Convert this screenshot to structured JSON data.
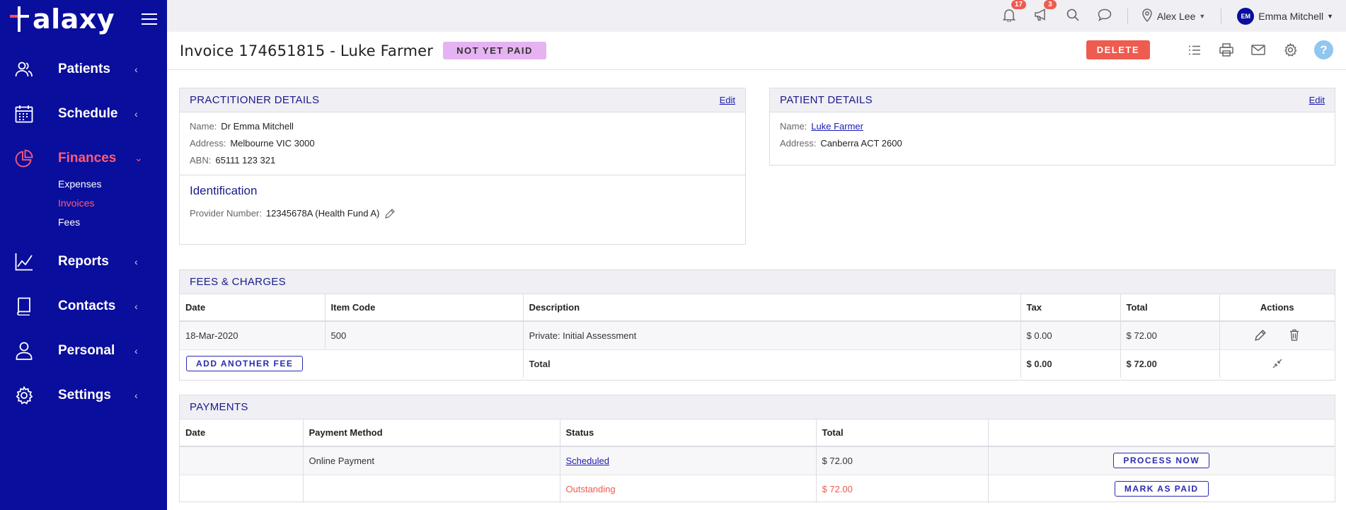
{
  "brand": {
    "name": "alaxy",
    "accent": "#ff4c6a",
    "sidebar_bg": "#0a0e9c"
  },
  "sidebar": {
    "items": [
      {
        "label": "Patients",
        "icon": "users-icon"
      },
      {
        "label": "Schedule",
        "icon": "calendar-icon"
      },
      {
        "label": "Finances",
        "icon": "pie-chart-icon",
        "active": true
      },
      {
        "label": "Reports",
        "icon": "line-chart-icon"
      },
      {
        "label": "Contacts",
        "icon": "book-icon"
      },
      {
        "label": "Personal",
        "icon": "user-icon"
      },
      {
        "label": "Settings",
        "icon": "gear-icon"
      }
    ],
    "finances_sub": [
      "Expenses",
      "Invoices",
      "Fees"
    ]
  },
  "topbar": {
    "notifications_count": "17",
    "announcements_count": "3",
    "location": "Alex Lee",
    "user_initials": "EM",
    "user_name": "Emma Mitchell"
  },
  "header": {
    "title": "Invoice 174651815 - Luke Farmer",
    "status": "NOT YET PAID",
    "delete_label": "DELETE",
    "help_label": "?"
  },
  "practitioner": {
    "heading": "PRACTITIONER DETAILS",
    "edit": "Edit",
    "name_label": "Name:",
    "name": "Dr Emma Mitchell",
    "address_label": "Address:",
    "address": "Melbourne VIC 3000",
    "abn_label": "ABN:",
    "abn": "65111 123 321",
    "ident_heading": "Identification",
    "provider_label": "Provider Number:",
    "provider_number": "12345678A (Health Fund A)"
  },
  "patient": {
    "heading": "PATIENT DETAILS",
    "edit": "Edit",
    "name_label": "Name:",
    "name": "Luke Farmer",
    "address_label": "Address:",
    "address": "Canberra ACT 2600"
  },
  "fees": {
    "heading": "FEES & CHARGES",
    "columns": [
      "Date",
      "Item Code",
      "Description",
      "Tax",
      "Total",
      "Actions"
    ],
    "rows": [
      {
        "date": "18-Mar-2020",
        "item_code": "500",
        "description": "Private: Initial Assessment",
        "tax": "$ 0.00",
        "total": "$ 72.00"
      }
    ],
    "add_label": "ADD ANOTHER FEE",
    "total_label": "Total",
    "total_tax": "$ 0.00",
    "total_amount": "$ 72.00"
  },
  "payments": {
    "heading": "PAYMENTS",
    "columns": [
      "Date",
      "Payment Method",
      "Status",
      "Total",
      ""
    ],
    "rows": [
      {
        "date": "",
        "method": "Online Payment",
        "status": "Scheduled",
        "total": "$ 72.00",
        "action": "PROCESS NOW"
      },
      {
        "date": "",
        "method": "",
        "status": "Outstanding",
        "total": "$ 72.00",
        "action": "MARK AS PAID"
      }
    ]
  }
}
